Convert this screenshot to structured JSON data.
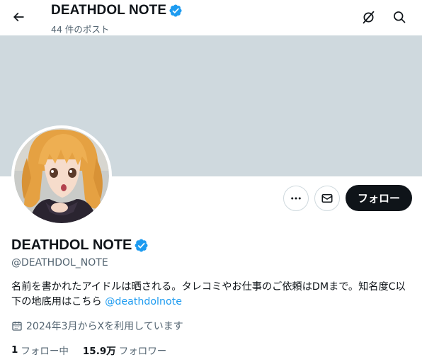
{
  "header": {
    "title": "DEATHDOL NOTE",
    "post_count": "44 件のポスト"
  },
  "profile": {
    "display_name": "DEATHDOL NOTE",
    "handle": "@DEATHDOL_NOTE",
    "bio_text": "名前を書かれたアイドルは晒される。タレコミやお仕事のご依頼はDMまで。知名度C以下の地底用はこちら ",
    "bio_link": "@deathdolnote",
    "joined": "2024年3月からXを利用しています",
    "following_count": "1",
    "following_label": "フォロー中",
    "followers_count": "15.9万",
    "followers_label": "フォロワー"
  },
  "actions": {
    "follow_label": "フォロー"
  },
  "icons": {
    "back": "arrow-left-icon",
    "grok": "grok-icon",
    "search": "search-icon",
    "verified": "verified-badge-icon",
    "more": "more-icon",
    "message": "envelope-icon",
    "calendar": "calendar-icon"
  },
  "colors": {
    "accent": "#1d9bf0",
    "banner": "#cfd9de",
    "text_primary": "#0f1419",
    "text_secondary": "#536471",
    "follow_button_bg": "#0f1419"
  }
}
